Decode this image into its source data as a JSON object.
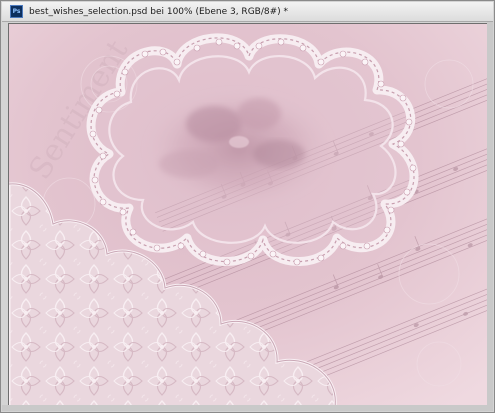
{
  "window": {
    "title": "best_wishes_selection.psd bei 100% (Ebene 3, RGB/8#) *",
    "app_icon": "photoshop-document-icon",
    "app_icon_glyph": "Ps"
  },
  "canvas": {
    "watermark_text": "Sentiment",
    "colors": {
      "background": "#e6c9d2",
      "lace": "#f6e9ee",
      "lace_shadow": "#c59aab",
      "damask": "#e9d4dc",
      "music_staff": "#9c7385"
    }
  }
}
